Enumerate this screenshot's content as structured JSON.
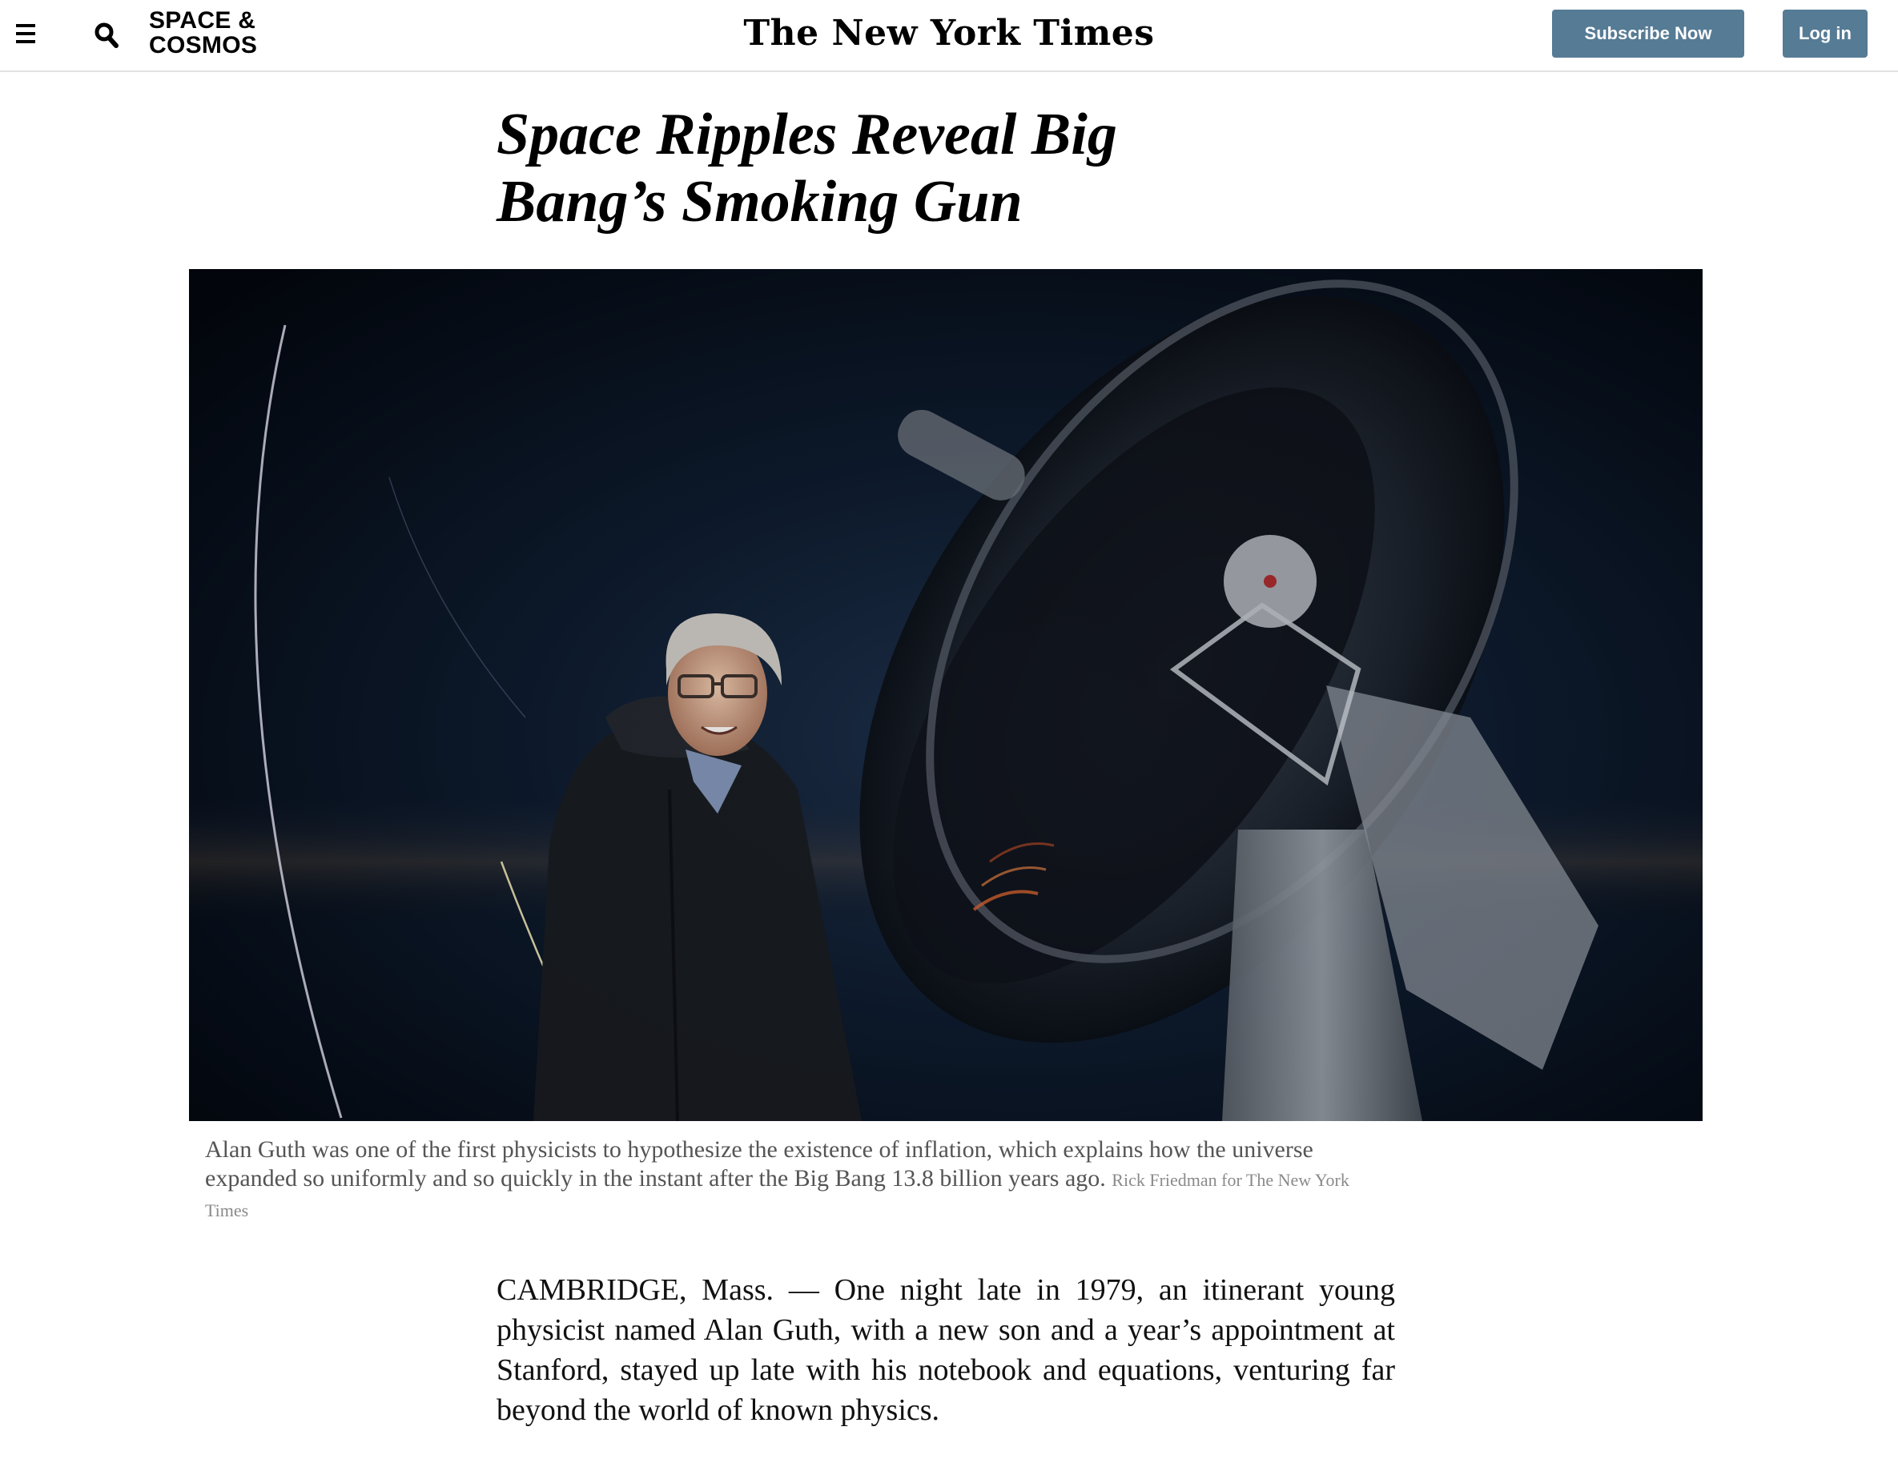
{
  "header": {
    "section": "SPACE & COSMOS",
    "masthead": "The New York Times",
    "subscribe_label": "Subscribe Now",
    "login_label": "Log in",
    "icons": [
      "menu-icon",
      "search-icon"
    ],
    "accent_color": "#567b95"
  },
  "article": {
    "headline": "Space Ripples Reveal Big Bang’s Smoking Gun",
    "image": {
      "description_icon": "photo-telescope-portrait"
    },
    "caption": "Alan Guth was one of the first physicists to hypothesize the existence of inflation, which explains how the universe expanded so uniformly and so quickly in the instant after the Big Bang 13.8 billion years ago.",
    "credit": "Rick Friedman for The New York Times",
    "body_first_paragraph": "CAMBRIDGE, Mass. — One night late in 1979, an itinerant young physicist named Alan Guth, with a new son and a year’s appointment at Stanford, stayed up late with his notebook and equations, venturing far beyond the world of known physics."
  }
}
